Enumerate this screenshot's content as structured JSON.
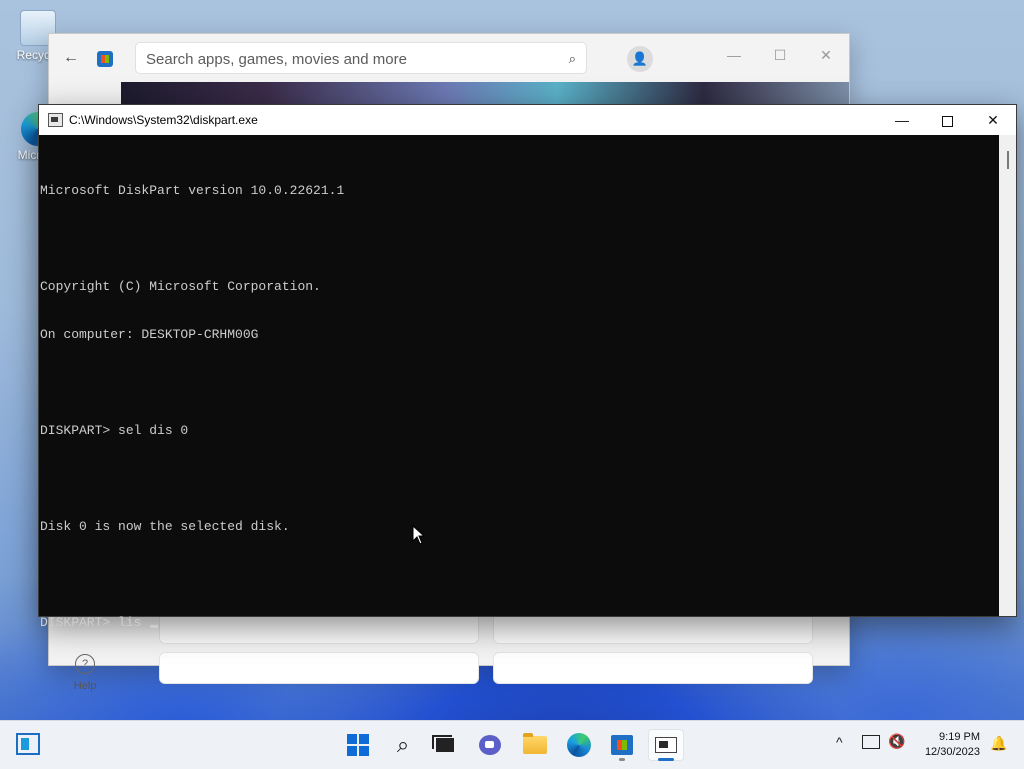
{
  "desktop": {
    "icons": [
      {
        "label": "Recycle",
        "icon": "recycle-bin-icon"
      },
      {
        "label": "Micr Ed",
        "icon": "edge-icon"
      }
    ]
  },
  "store_window": {
    "search_placeholder": "Search apps, games, movies and more",
    "nav_help_label": "Help",
    "icons": {
      "back": "back-arrow-icon",
      "search": "search-icon",
      "account": "user-icon",
      "help": "help-icon"
    },
    "controls": {
      "minimize": "—",
      "maximize": "☐",
      "close": "✕"
    }
  },
  "console_window": {
    "title": "C:\\Windows\\System32\\diskpart.exe",
    "controls": {
      "minimize": "—",
      "close": "✕"
    },
    "lines": [
      "Microsoft DiskPart version 10.0.22621.1",
      "",
      "Copyright (C) Microsoft Corporation.",
      "On computer: DESKTOP-CRHM00G",
      "",
      "DISKPART> sel dis 0",
      "",
      "Disk 0 is now the selected disk.",
      "",
      "DISKPART> lis "
    ]
  },
  "taskbar": {
    "apps": [
      {
        "name": "start",
        "icon": "windows-start-icon"
      },
      {
        "name": "search",
        "icon": "search-icon"
      },
      {
        "name": "task-view",
        "icon": "task-view-icon"
      },
      {
        "name": "chat",
        "icon": "teams-chat-icon"
      },
      {
        "name": "file-explorer",
        "icon": "folder-icon"
      },
      {
        "name": "edge",
        "icon": "edge-icon"
      },
      {
        "name": "store",
        "icon": "store-icon"
      },
      {
        "name": "command-prompt",
        "icon": "console-icon"
      }
    ],
    "tray": {
      "chevron": "^",
      "time": "9:19 PM",
      "date": "12/30/2023"
    }
  }
}
